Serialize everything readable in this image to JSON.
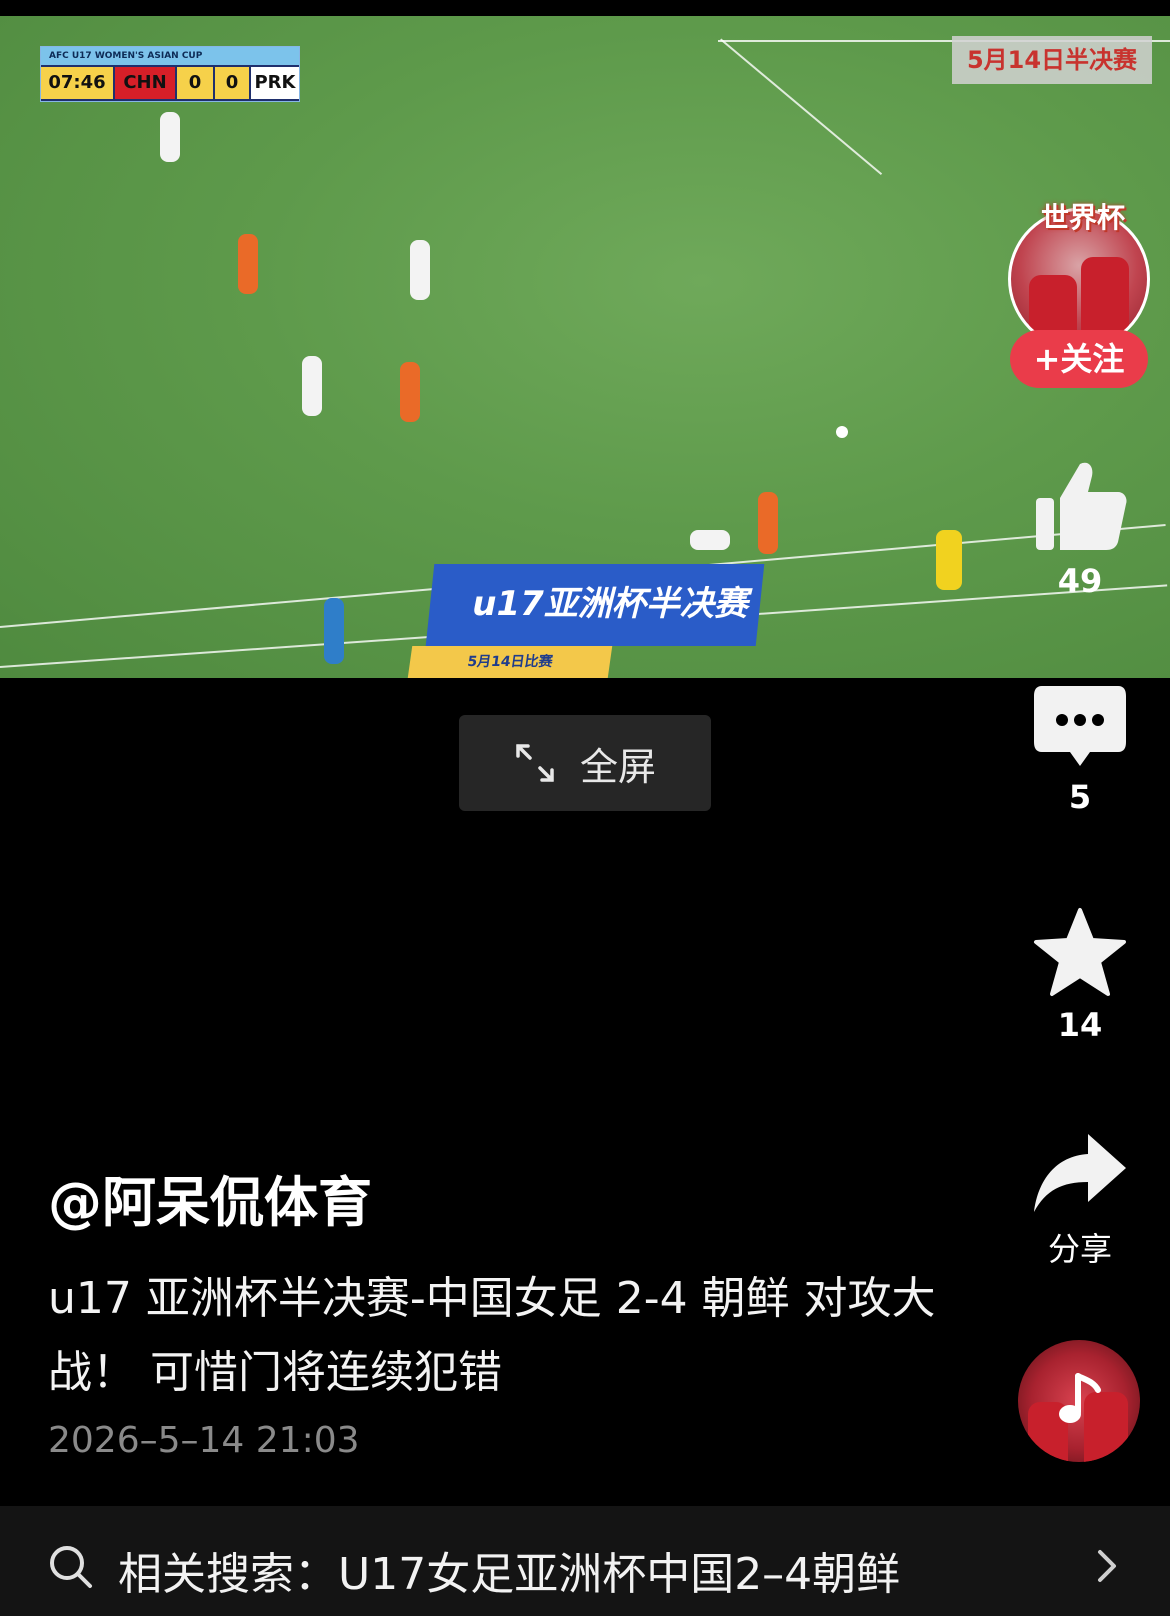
{
  "video": {
    "scoreboard": {
      "tournament": "AFC U17 WOMEN'S ASIAN CUP",
      "time": "07:46",
      "home": "CHN",
      "home_score": "0",
      "away_score": "0",
      "away": "PRK"
    },
    "corner_tag": "5月14日半决赛",
    "banner_title": "u17亚洲杯半决赛",
    "banner_date": "5月14日比赛",
    "fullscreen_label": "全屏"
  },
  "sidebar": {
    "avatar_badge": "世界杯",
    "follow_label": "+关注",
    "like_count": "49",
    "comment_count": "5",
    "favorite_count": "14",
    "share_label": "分享"
  },
  "post": {
    "author": "@阿呆侃体育",
    "caption": "u17 亚洲杯半决赛-中国女足 2-4 朝鲜 对攻大战！ 可惜门将连续犯错",
    "timestamp": "2026–5–14  21:03"
  },
  "related_search": {
    "label": "相关搜索：U17女足亚洲杯中国2–4朝鲜"
  },
  "colors": {
    "accent_red": "#ea3c4a",
    "background": "#000000",
    "search_bar": "#141414"
  }
}
